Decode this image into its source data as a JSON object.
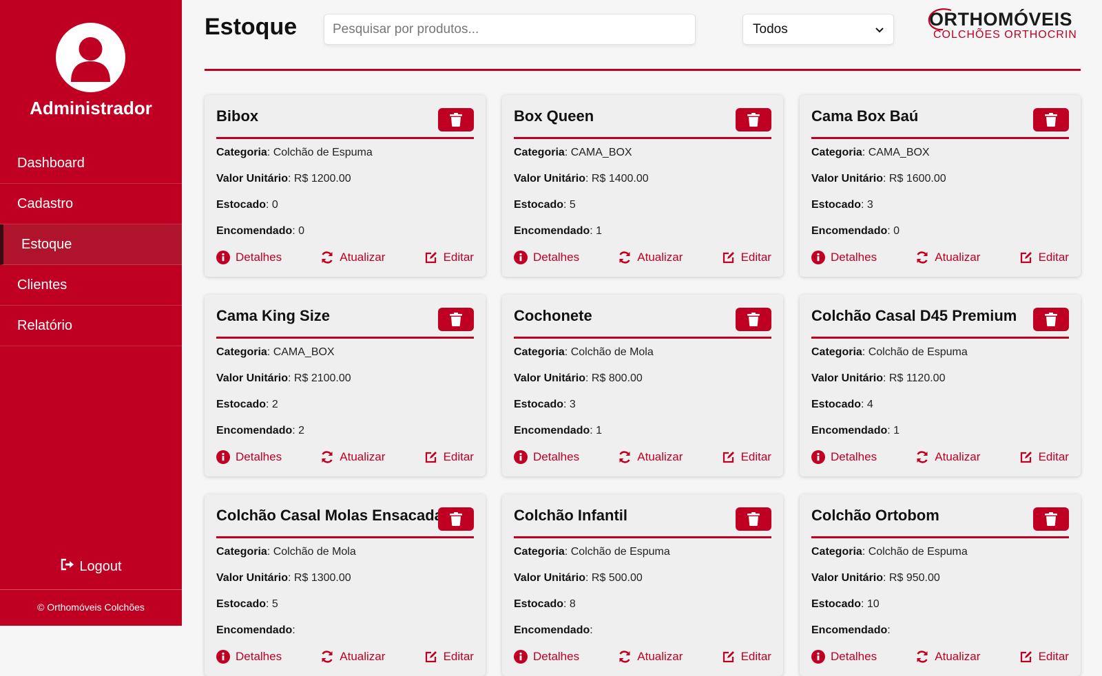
{
  "sidebar": {
    "user_name": "Administrador",
    "nav": [
      {
        "label": "Dashboard"
      },
      {
        "label": "Cadastro"
      },
      {
        "label": "Estoque"
      },
      {
        "label": "Clientes"
      },
      {
        "label": "Relatório"
      }
    ],
    "active_index": 2,
    "logout_label": "Logout",
    "footer": "© Orthomóveis Colchões"
  },
  "header": {
    "title": "Estoque",
    "search_placeholder": "Pesquisar por produtos...",
    "filter_selected": "Todos",
    "brand_line1": "ORTHOMÓVEIS",
    "brand_line2": "COLCHÕES ORTHOCRIN"
  },
  "labels": {
    "categoria": "Categoria",
    "valor": "Valor Unitário",
    "estocado": "Estocado",
    "encomendado": "Encomendado",
    "detalhes": "Detalhes",
    "atualizar": "Atualizar",
    "editar": "Editar"
  },
  "colors": {
    "brand_red": "#c00022"
  },
  "products": [
    {
      "name": "Bibox",
      "categoria": "Colchão de Espuma",
      "valor": "R$ 1200.00",
      "estocado": "0",
      "encomendado": "0"
    },
    {
      "name": "Box Queen",
      "categoria": "CAMA_BOX",
      "valor": "R$ 1400.00",
      "estocado": "5",
      "encomendado": "1"
    },
    {
      "name": "Cama Box Baú",
      "categoria": "CAMA_BOX",
      "valor": "R$ 1600.00",
      "estocado": "3",
      "encomendado": "0"
    },
    {
      "name": "Cama King Size",
      "categoria": "CAMA_BOX",
      "valor": "R$ 2100.00",
      "estocado": "2",
      "encomendado": "2"
    },
    {
      "name": "Cochonete",
      "categoria": "Colchão de Mola",
      "valor": "R$ 800.00",
      "estocado": "3",
      "encomendado": "1"
    },
    {
      "name": "Colchão Casal D45 Premium",
      "categoria": "Colchão de Espuma",
      "valor": "R$ 1120.00",
      "estocado": "4",
      "encomendado": "1"
    },
    {
      "name": "Colchão Casal Molas Ensacadas",
      "categoria": "Colchão de Mola",
      "valor": "R$ 1300.00",
      "estocado": "5",
      "encomendado": ""
    },
    {
      "name": "Colchão Infantil",
      "categoria": "Colchão de Espuma",
      "valor": "R$ 500.00",
      "estocado": "8",
      "encomendado": ""
    },
    {
      "name": "Colchão Ortobom",
      "categoria": "Colchão de Espuma",
      "valor": "R$ 950.00",
      "estocado": "10",
      "encomendado": ""
    }
  ]
}
